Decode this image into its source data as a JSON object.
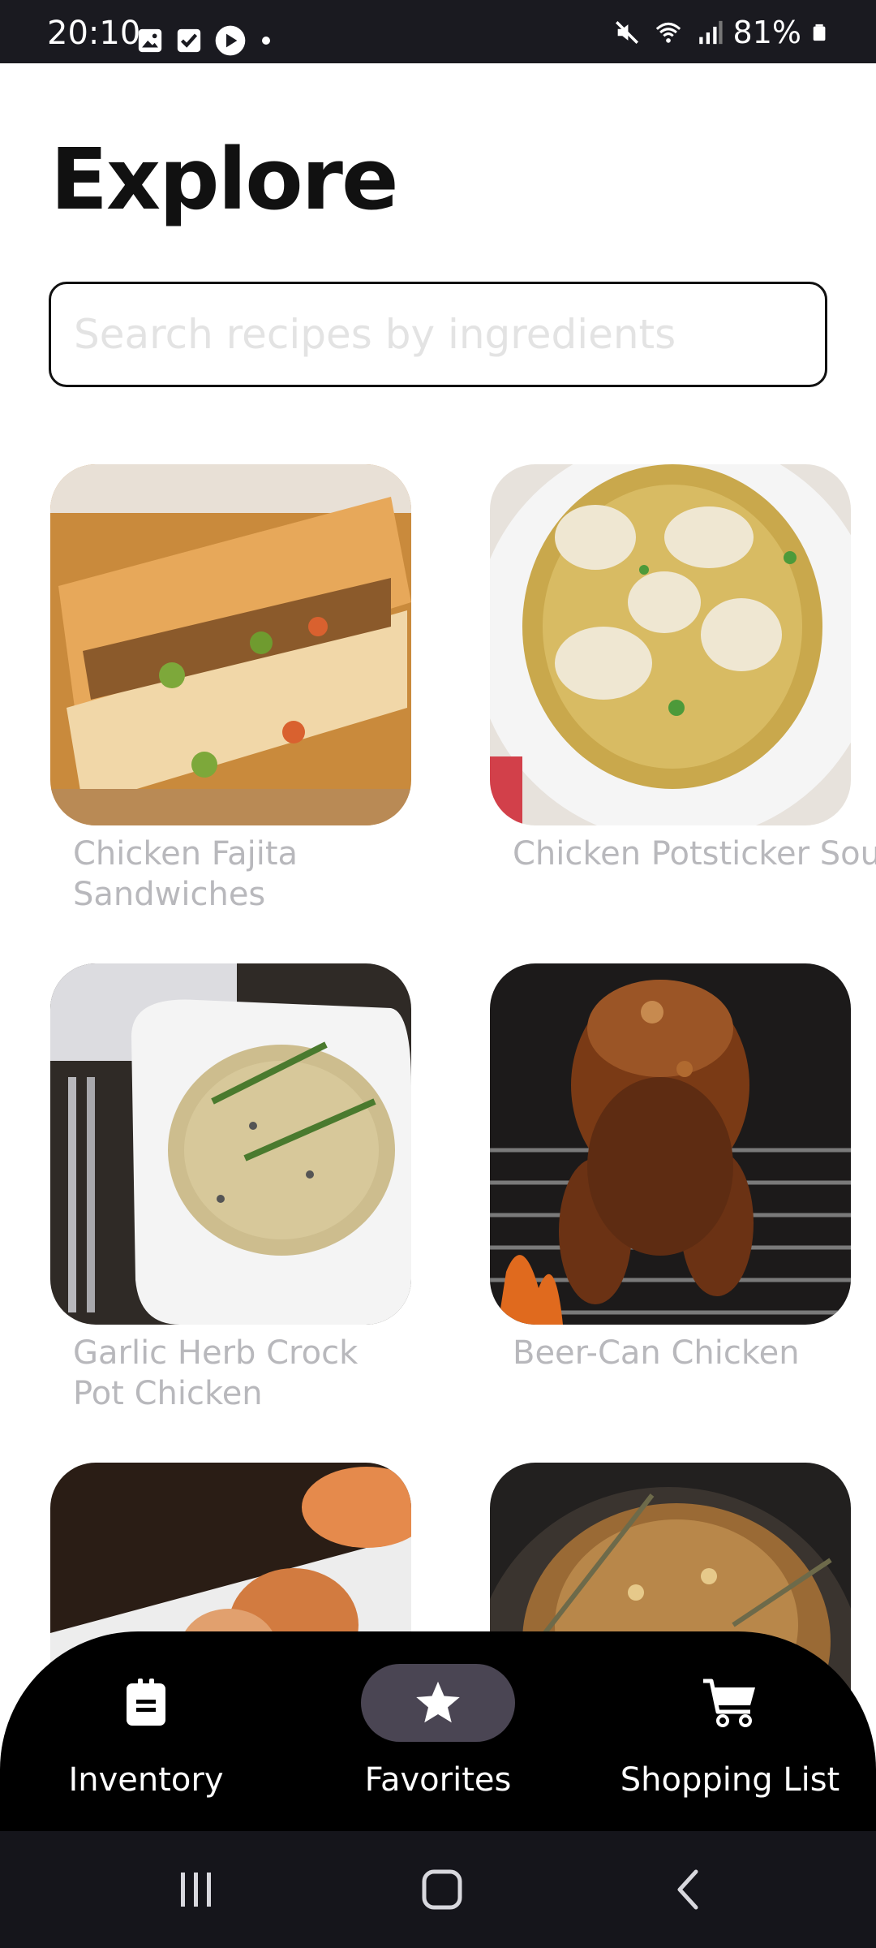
{
  "status_bar": {
    "time": "20:10",
    "battery": "81%",
    "left_icons": [
      "gallery-icon",
      "checkbox-icon",
      "play-icon",
      "dot-icon"
    ],
    "right_icons": [
      "mute-icon",
      "wifi-icon",
      "signal-icon",
      "battery-icon"
    ]
  },
  "header": {
    "title": "Explore"
  },
  "search": {
    "placeholder": "Search recipes by ingredients",
    "value": ""
  },
  "recipes": [
    {
      "name": "Chicken Fajita Sandwiches"
    },
    {
      "name": "Chicken Potsticker Soup"
    },
    {
      "name": "Garlic Herb Crock Pot Chicken"
    },
    {
      "name": "Beer-Can Chicken"
    },
    {
      "name": ""
    },
    {
      "name": ""
    }
  ],
  "bottom_nav": {
    "items": [
      {
        "label": "Inventory",
        "icon": "clipboard-icon",
        "active": false
      },
      {
        "label": "Favorites",
        "icon": "star-icon",
        "active": true
      },
      {
        "label": "Shopping List",
        "icon": "cart-icon",
        "active": false
      }
    ],
    "active_pill_color": "#4a4553"
  },
  "system_nav": {
    "icons": [
      "recents-icon",
      "home-icon",
      "back-icon"
    ]
  },
  "colors": {
    "text": "#111111",
    "label": "#b8b8bc",
    "nav_bg": "#000000",
    "status_bg": "#1a1a20"
  }
}
